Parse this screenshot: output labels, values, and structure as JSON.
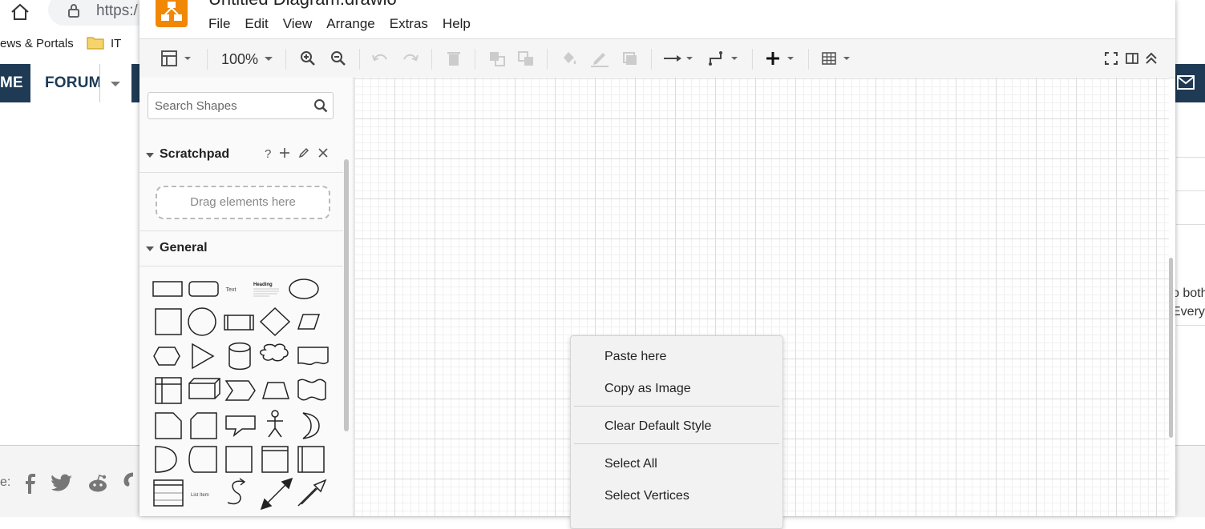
{
  "browser": {
    "url_text": "https:/",
    "bookmarks": {
      "portals": "ews & Portals",
      "it": "IT"
    },
    "nav": {
      "partial_left": "ME",
      "forums": "FORUMS"
    },
    "side_text": {
      "line1": "o both",
      "line2": "Everyo"
    },
    "share_label": "e:"
  },
  "app": {
    "title": "Untitled Diagram.drawio",
    "menu": [
      "File",
      "Edit",
      "View",
      "Arrange",
      "Extras",
      "Help"
    ],
    "toolbar": {
      "zoom": "100%"
    },
    "sidebar": {
      "search_placeholder": "Search Shapes",
      "scratchpad_title": "Scratchpad",
      "scratchpad_help": "?",
      "drag_hint": "Drag elements here",
      "general_title": "General",
      "shape_text": "Text",
      "shape_heading": "Heading",
      "shape_list_item": "List Item"
    },
    "context_menu": {
      "paste_here": "Paste here",
      "copy_as_image": "Copy as Image",
      "clear_default_style": "Clear Default Style",
      "select_all": "Select All",
      "select_vertices": "Select Vertices"
    }
  },
  "colors": {
    "nav_bg": "#1e3a55",
    "logo": "#f08705",
    "grid": "#dcdcdc"
  }
}
